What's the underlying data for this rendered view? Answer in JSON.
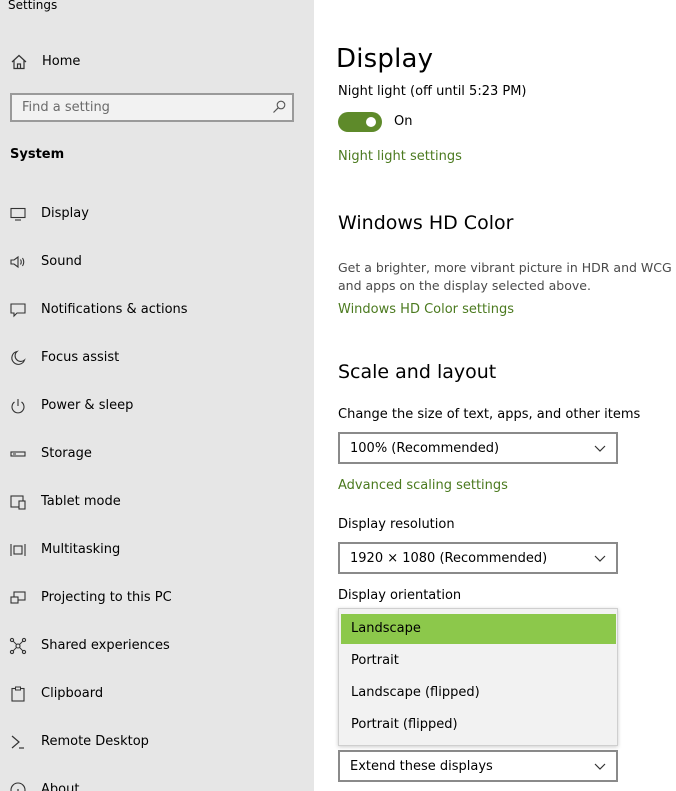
{
  "window": {
    "title": "Settings"
  },
  "sidebar": {
    "home_label": "Home",
    "search_placeholder": "Find a setting",
    "section_label": "System",
    "items": [
      {
        "label": "Display",
        "icon": "monitor-icon"
      },
      {
        "label": "Sound",
        "icon": "speaker-icon"
      },
      {
        "label": "Notifications & actions",
        "icon": "message-icon"
      },
      {
        "label": "Focus assist",
        "icon": "moon-icon"
      },
      {
        "label": "Power & sleep",
        "icon": "power-icon"
      },
      {
        "label": "Storage",
        "icon": "drive-icon"
      },
      {
        "label": "Tablet mode",
        "icon": "tablet-icon"
      },
      {
        "label": "Multitasking",
        "icon": "multitask-icon"
      },
      {
        "label": "Projecting to this PC",
        "icon": "project-icon"
      },
      {
        "label": "Shared experiences",
        "icon": "share-icon"
      },
      {
        "label": "Clipboard",
        "icon": "clipboard-icon"
      },
      {
        "label": "Remote Desktop",
        "icon": "remote-icon"
      },
      {
        "label": "About",
        "icon": "info-icon"
      }
    ]
  },
  "main": {
    "title": "Display",
    "night_light": {
      "label": "Night light (off until 5:23 PM)",
      "toggle_state": "On",
      "settings_link": "Night light settings"
    },
    "hd_color": {
      "heading": "Windows HD Color",
      "description_line1": "Get a brighter, more vibrant picture in HDR and WCG v",
      "description_line2": "and apps on the display selected above.",
      "settings_link": "Windows HD Color settings"
    },
    "scale_layout": {
      "heading": "Scale and layout",
      "scale_label": "Change the size of text, apps, and other items",
      "scale_value": "100% (Recommended)",
      "advanced_link": "Advanced scaling settings",
      "resolution_label": "Display resolution",
      "resolution_value": "1920 × 1080 (Recommended)",
      "orientation_label": "Display orientation",
      "orientation_options": [
        "Landscape",
        "Portrait",
        "Landscape (flipped)",
        "Portrait (flipped)"
      ],
      "orientation_selected": "Landscape",
      "multiple_displays_value": "Extend these displays"
    }
  },
  "colors": {
    "accent": "#5e8a2a",
    "link": "#4b7a1f",
    "selected_option": "#8cc84b",
    "sidebar_bg": "#e6e6e6"
  }
}
